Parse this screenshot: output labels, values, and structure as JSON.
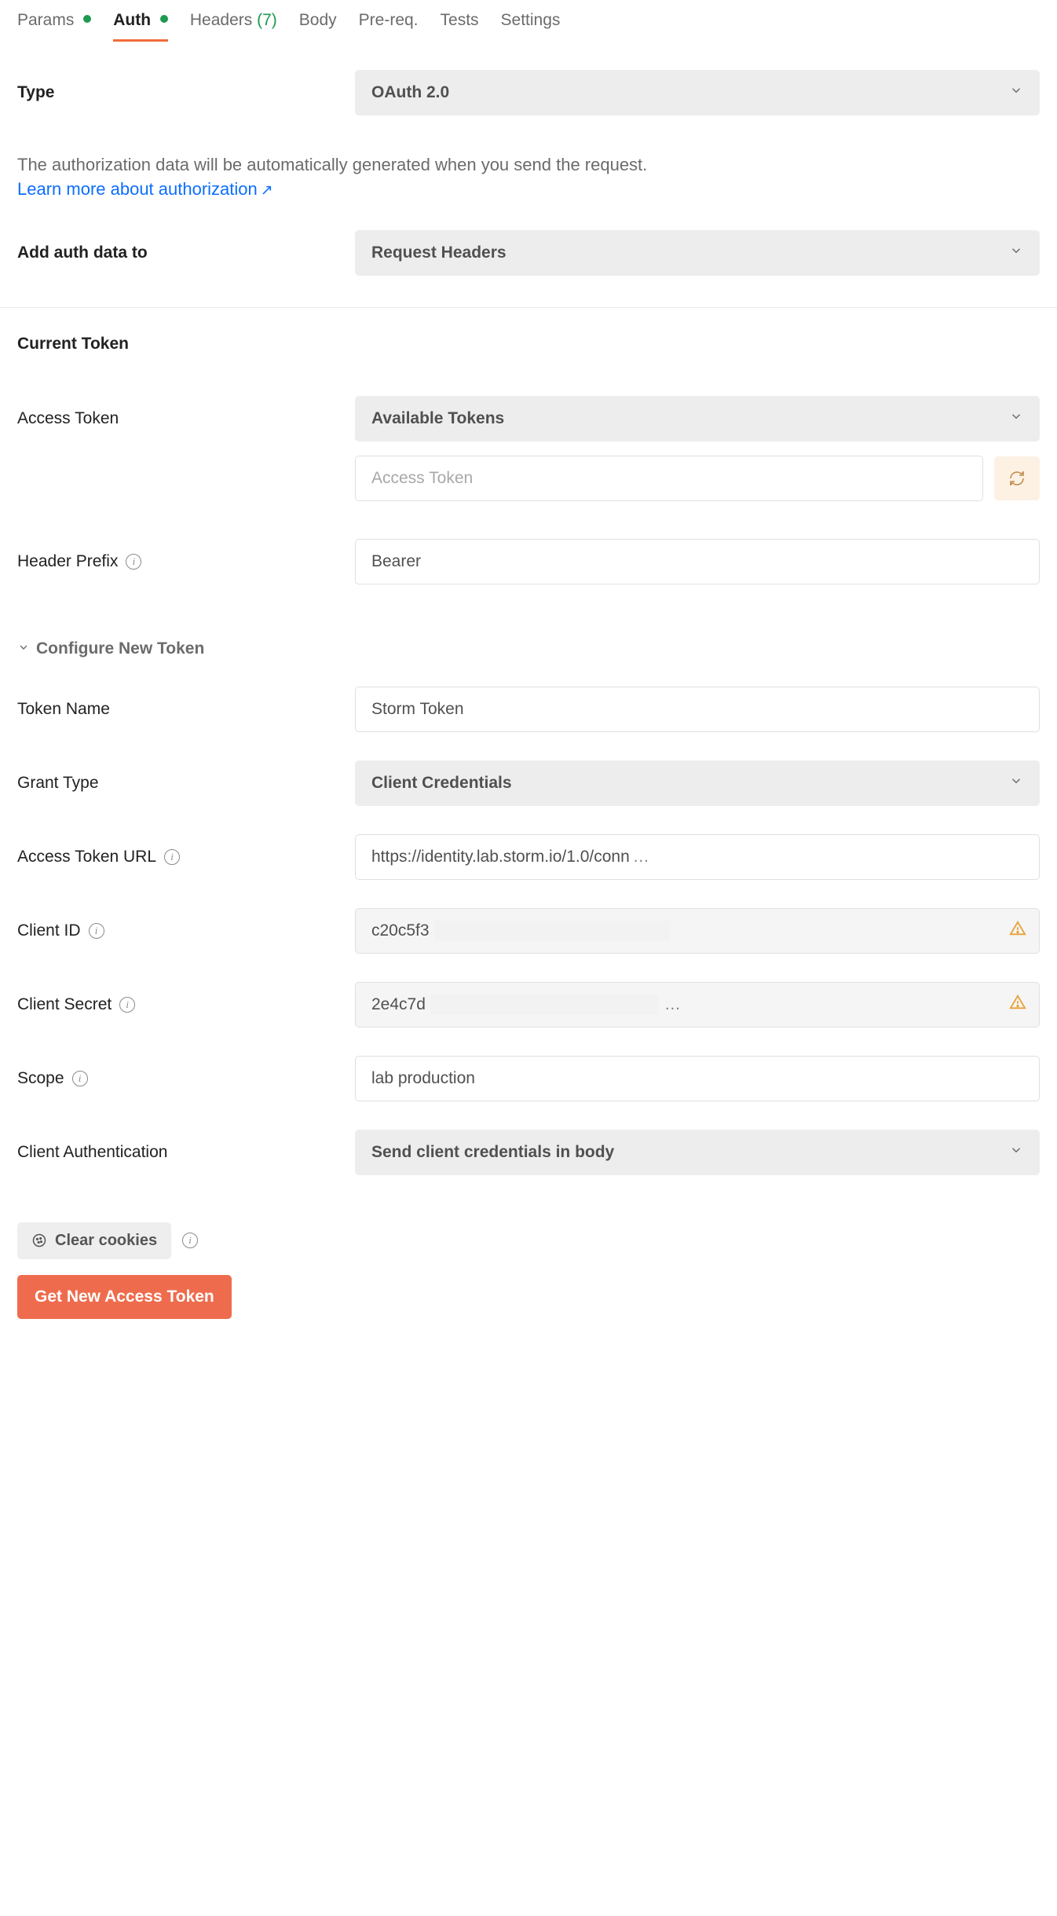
{
  "tabs": {
    "params": "Params",
    "auth": "Auth",
    "headers": "Headers",
    "headers_count": "(7)",
    "body": "Body",
    "prereq": "Pre-req.",
    "tests": "Tests",
    "settings": "Settings"
  },
  "auth": {
    "type_label": "Type",
    "type_value": "OAuth 2.0",
    "desc": "The authorization data will be automatically generated when you send the request.",
    "learn_more": "Learn more about authorization",
    "add_to_label": "Add auth data to",
    "add_to_value": "Request Headers"
  },
  "current_token": {
    "section": "Current Token",
    "access_token_label": "Access Token",
    "available_tokens": "Available Tokens",
    "access_token_placeholder": "Access Token",
    "header_prefix_label": "Header Prefix",
    "header_prefix_value": "Bearer"
  },
  "configure": {
    "section": "Configure New Token",
    "token_name_label": "Token Name",
    "token_name_value": "Storm Token",
    "grant_type_label": "Grant Type",
    "grant_type_value": "Client Credentials",
    "access_token_url_label": "Access Token URL",
    "access_token_url_value": "https://identity.lab.storm.io/1.0/conn",
    "client_id_label": "Client ID",
    "client_id_value": "c20c5f3",
    "client_secret_label": "Client Secret",
    "client_secret_value": "2e4c7d",
    "scope_label": "Scope",
    "scope_value": "lab production",
    "client_auth_label": "Client Authentication",
    "client_auth_value": "Send client credentials in body"
  },
  "actions": {
    "clear_cookies": "Clear cookies",
    "get_token": "Get New Access Token"
  }
}
